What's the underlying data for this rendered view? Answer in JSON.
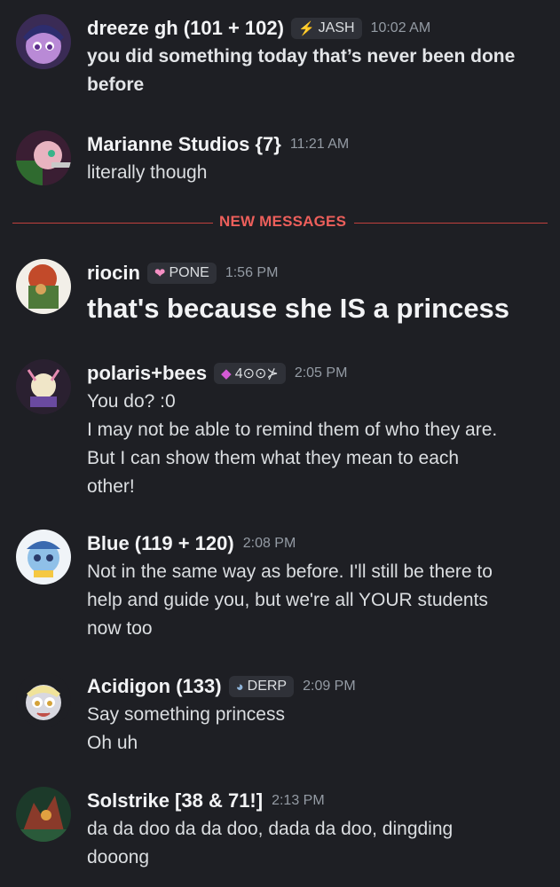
{
  "divider": {
    "label": "NEW MESSAGES"
  },
  "messages": [
    {
      "author": "dreeze gh (101 + 102)",
      "tag": "JASH",
      "time": "10:02 AM",
      "lines": [
        "you did something today that’s never been done",
        "before"
      ]
    },
    {
      "author": "Marianne Studios {7}",
      "time": "11:21 AM",
      "lines": [
        "literally though"
      ]
    },
    {
      "author": "riocin",
      "tag": "PONE",
      "time": "1:56 PM",
      "lines": [
        "that's because she IS a princess"
      ]
    },
    {
      "author": "polaris+bees",
      "tag": "4⊙⊙⊁",
      "time": "2:05 PM",
      "lines": [
        "You do? :0",
        "I may not be able to remind them of who they are.",
        "But I can show them what they mean to each",
        "other!"
      ]
    },
    {
      "author": "Blue (119 + 120)",
      "time": "2:08 PM",
      "lines": [
        "Not in the same way as before. I'll still be there to",
        "help and guide you, but we're all YOUR students",
        "now too"
      ]
    },
    {
      "author": "Acidigon (133)",
      "tag": "DERP",
      "time": "2:09 PM",
      "lines": [
        "Say something princess",
        "Oh uh"
      ]
    },
    {
      "author": "Solstrike [38 & 71!]",
      "time": "2:13 PM",
      "lines": [
        "da da doo da da doo, dada da doo, dingding",
        "dooong"
      ]
    }
  ],
  "icons": {
    "jash": "lightning-icon",
    "pone": "heart-icon",
    "polaris": "gem-icon",
    "derp": "bubble-icon"
  },
  "colors": {
    "background": "#1e1f24",
    "new_messages": "#ed5f5b",
    "tag_bg": "#2f3138"
  }
}
